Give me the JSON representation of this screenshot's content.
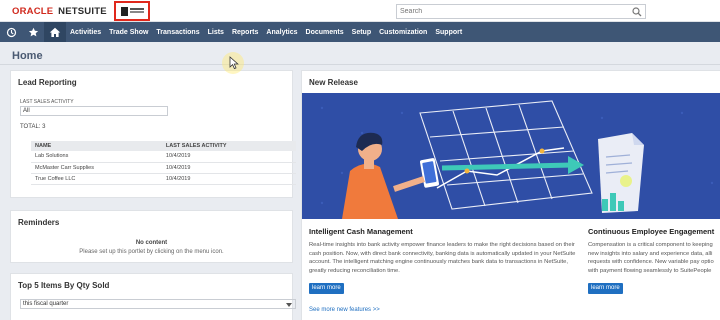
{
  "header": {
    "brand_oracle": "ORACLE",
    "brand_netsuite": "NETSUITE",
    "search_placeholder": "Search"
  },
  "nav": {
    "items": [
      "Activities",
      "Trade Show",
      "Transactions",
      "Lists",
      "Reports",
      "Analytics",
      "Documents",
      "Setup",
      "Customization",
      "Support"
    ],
    "icons": [
      "recent-icon",
      "star-icon",
      "home-icon"
    ]
  },
  "page": {
    "title": "Home"
  },
  "lead_reporting": {
    "title": "Lead Reporting",
    "filter_label": "LAST SALES ACTIVITY",
    "filter_value": "All",
    "total": "TOTAL: 3",
    "columns": [
      "NAME",
      "LAST SALES ACTIVITY"
    ],
    "rows": [
      [
        "Lab Solutions",
        "10/4/2019"
      ],
      [
        "McMaster Carr Supplies",
        "10/4/2019"
      ],
      [
        "True Coffee LLC",
        "10/4/2019"
      ]
    ]
  },
  "reminders": {
    "title": "Reminders",
    "no_content": "No content",
    "hint": "Please set up this portlet by clicking on the menu icon."
  },
  "top_items": {
    "title": "Top 5 Items By Qty Sold",
    "period": "this fiscal quarter"
  },
  "new_release": {
    "title": "New Release",
    "features": [
      {
        "title": "Intelligent Cash Management",
        "text": "Real-time insights into bank activity empower finance leaders to make the right decisions based on their cash position. Now, with direct bank connectivity, banking data is automatically updated in your NetSuite account. The intelligent matching engine continuously matches bank data to transactions in NetSuite, greatly reducing reconciliation time.",
        "button": "learn more"
      },
      {
        "title": "Continuous Employee Engagement",
        "text": "Compensation is a critical component to keeping new insights into salary and experience data, alli requests with confidence. New variable pay optio with payment flowing seamlessly to SuitePeople",
        "button": "learn more"
      }
    ],
    "see_more": "See more new features >>"
  },
  "colors": {
    "navbar": "#3e5675",
    "oracle_red": "#d0291d",
    "hero_blue": "#2f4ea6",
    "button_blue": "#1f6fc1"
  }
}
